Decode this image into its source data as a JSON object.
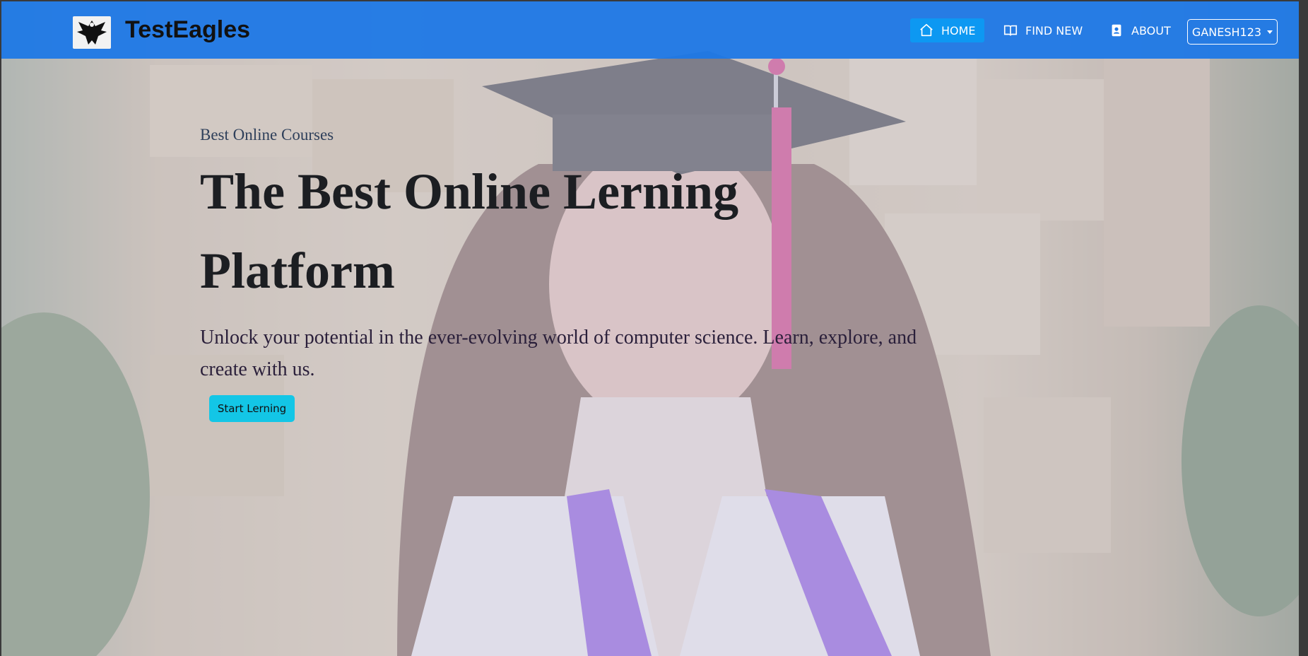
{
  "brand": {
    "name": "TestEagles",
    "logo_icon": "eagle-logo-icon"
  },
  "nav": {
    "items": [
      {
        "label": "HOME",
        "icon": "home-icon",
        "active": true
      },
      {
        "label": "FIND NEW",
        "icon": "book-icon",
        "active": false
      },
      {
        "label": "ABOUT",
        "icon": "contact-card-icon",
        "active": false
      }
    ],
    "user": {
      "label": "GANESH123",
      "icon": "caret-down-icon"
    }
  },
  "hero": {
    "kicker": "Best Online Courses",
    "headline": "The Best Online Lerning Platform",
    "subtext": "Unlock your potential in the ever-evolving world of computer science. Learn, explore, and create with us.",
    "cta_label": "Start Lerning"
  },
  "colors": {
    "navbar": "#1e78e6",
    "nav_active": "#0d98f2",
    "cta": "#13c6e6",
    "headline": "#1c1e22"
  }
}
